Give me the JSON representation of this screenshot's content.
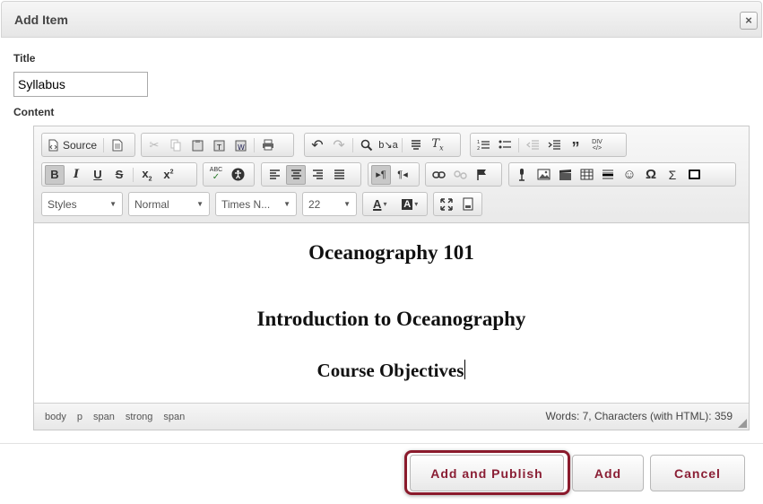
{
  "dialog": {
    "title": "Add Item",
    "close_symbol": "×"
  },
  "form": {
    "title_label": "Title",
    "title_value": "Syllabus",
    "content_label": "Content"
  },
  "toolbar": {
    "source_label": "Source",
    "format_selects": [
      {
        "name": "styles",
        "value": "Styles"
      },
      {
        "name": "format",
        "value": "Normal"
      },
      {
        "name": "font",
        "value": "Times N..."
      },
      {
        "name": "size",
        "value": "22"
      }
    ]
  },
  "content": {
    "line1": "Oceanography 101",
    "line2": "Introduction to Oceanography",
    "line3": "Course Objectives"
  },
  "status": {
    "path": [
      "body",
      "p",
      "span",
      "strong",
      "span"
    ],
    "wordcount": "Words: 7, Characters (with HTML): 359"
  },
  "buttons": {
    "add_publish": "Add and Publish",
    "add": "Add",
    "cancel": "Cancel"
  },
  "colors": {
    "accent": "#8a1e34",
    "highlight": "#8a1a2c"
  }
}
